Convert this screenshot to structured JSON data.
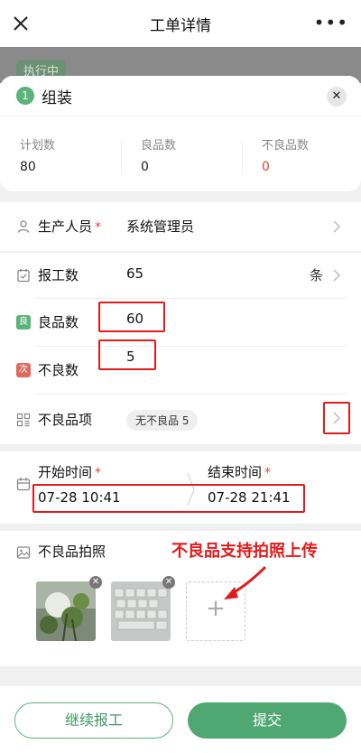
{
  "header": {
    "title": "工单详情",
    "more": "•••"
  },
  "behind": {
    "status_tag": "执行中"
  },
  "step": {
    "number": "1",
    "name": "组装"
  },
  "stats": [
    {
      "label": "计划数",
      "value": "80"
    },
    {
      "label": "良品数",
      "value": "0"
    },
    {
      "label": "不良品数",
      "value": "0"
    }
  ],
  "operator": {
    "label": "生产人员",
    "required": "*",
    "value": "系统管理员"
  },
  "report": {
    "label": "报工数",
    "value": "65",
    "unit": "条"
  },
  "good": {
    "label": "良品数",
    "icon_char": "良",
    "value": "60"
  },
  "defect": {
    "label": "不良数",
    "icon_char": "次",
    "value": "5"
  },
  "defect_items": {
    "label": "不良品项",
    "pill": "无不良品  5"
  },
  "time": {
    "start_label": "开始时间",
    "end_label": "结束时间",
    "required": "*",
    "start_value": "07-28 10:41",
    "end_value": "07-28 21:41"
  },
  "photos": {
    "label": "不良品拍照",
    "annotation": "不良品支持拍照上传",
    "add_symbol": "+"
  },
  "footer": {
    "continue_label": "继续报工",
    "submit_label": "提交"
  },
  "colors": {
    "accent": "#4fa871",
    "danger": "#e0433a",
    "highlight": "#e21b1b"
  }
}
